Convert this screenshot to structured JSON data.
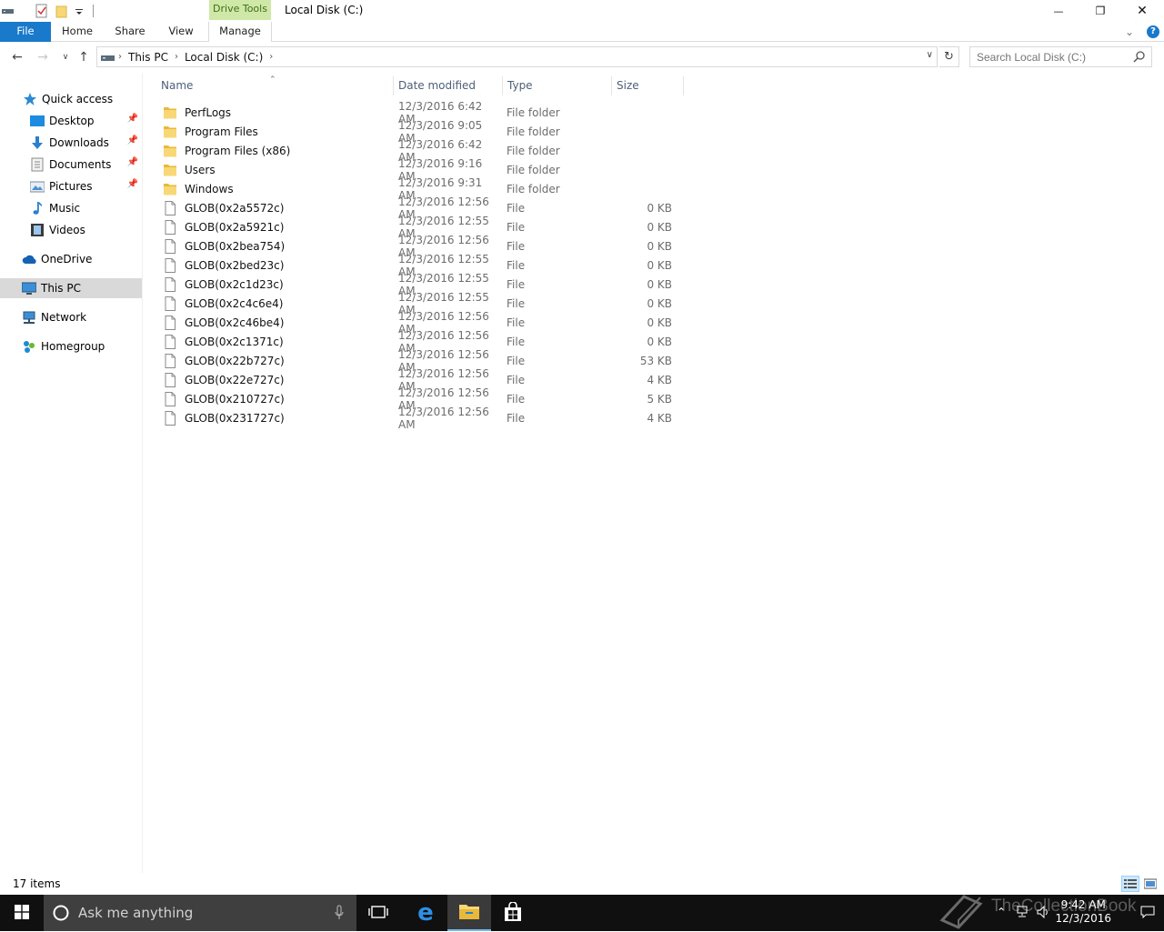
{
  "window": {
    "title": "Local Disk (C:)",
    "context_tab": "Drive Tools",
    "minimize_glyph": "—",
    "maximize_glyph": "❐",
    "close_glyph": "✕"
  },
  "ribbon": {
    "tabs": [
      "File",
      "Home",
      "Share",
      "View",
      "Manage"
    ],
    "collapse_glyph": "⌄",
    "help_glyph": "?"
  },
  "address": {
    "crumbs": [
      "This PC",
      "Local Disk (C:)"
    ],
    "separator": "›",
    "search_placeholder": "Search Local Disk (C:)"
  },
  "nav_pane": {
    "items": [
      {
        "label": "Quick access",
        "icon": "star-icon"
      },
      {
        "label": "Desktop",
        "icon": "desktop-icon",
        "pinned": true
      },
      {
        "label": "Downloads",
        "icon": "download-icon",
        "pinned": true
      },
      {
        "label": "Documents",
        "icon": "documents-icon",
        "pinned": true
      },
      {
        "label": "Pictures",
        "icon": "pictures-icon",
        "pinned": true
      },
      {
        "label": "Music",
        "icon": "music-icon"
      },
      {
        "label": "Videos",
        "icon": "videos-icon"
      },
      {
        "label": "OneDrive",
        "icon": "cloud-icon"
      },
      {
        "label": "This PC",
        "icon": "computer-icon",
        "selected": true
      },
      {
        "label": "Network",
        "icon": "network-icon"
      },
      {
        "label": "Homegroup",
        "icon": "homegroup-icon"
      }
    ]
  },
  "file_list": {
    "columns": [
      "Name",
      "Date modified",
      "Type",
      "Size"
    ],
    "rows": [
      {
        "name": "PerfLogs",
        "date": "12/3/2016 6:42 AM",
        "type": "File folder",
        "size": "",
        "kind": "folder"
      },
      {
        "name": "Program Files",
        "date": "12/3/2016 9:05 AM",
        "type": "File folder",
        "size": "",
        "kind": "folder"
      },
      {
        "name": "Program Files (x86)",
        "date": "12/3/2016 6:42 AM",
        "type": "File folder",
        "size": "",
        "kind": "folder"
      },
      {
        "name": "Users",
        "date": "12/3/2016 9:16 AM",
        "type": "File folder",
        "size": "",
        "kind": "folder"
      },
      {
        "name": "Windows",
        "date": "12/3/2016 9:31 AM",
        "type": "File folder",
        "size": "",
        "kind": "folder"
      },
      {
        "name": "GLOB(0x2a5572c)",
        "date": "12/3/2016 12:56 AM",
        "type": "File",
        "size": "0 KB",
        "kind": "file"
      },
      {
        "name": "GLOB(0x2a5921c)",
        "date": "12/3/2016 12:55 AM",
        "type": "File",
        "size": "0 KB",
        "kind": "file"
      },
      {
        "name": "GLOB(0x2bea754)",
        "date": "12/3/2016 12:56 AM",
        "type": "File",
        "size": "0 KB",
        "kind": "file"
      },
      {
        "name": "GLOB(0x2bed23c)",
        "date": "12/3/2016 12:55 AM",
        "type": "File",
        "size": "0 KB",
        "kind": "file"
      },
      {
        "name": "GLOB(0x2c1d23c)",
        "date": "12/3/2016 12:55 AM",
        "type": "File",
        "size": "0 KB",
        "kind": "file"
      },
      {
        "name": "GLOB(0x2c4c6e4)",
        "date": "12/3/2016 12:55 AM",
        "type": "File",
        "size": "0 KB",
        "kind": "file"
      },
      {
        "name": "GLOB(0x2c46be4)",
        "date": "12/3/2016 12:56 AM",
        "type": "File",
        "size": "0 KB",
        "kind": "file"
      },
      {
        "name": "GLOB(0x2c1371c)",
        "date": "12/3/2016 12:56 AM",
        "type": "File",
        "size": "0 KB",
        "kind": "file"
      },
      {
        "name": "GLOB(0x22b727c)",
        "date": "12/3/2016 12:56 AM",
        "type": "File",
        "size": "53 KB",
        "kind": "file"
      },
      {
        "name": "GLOB(0x22e727c)",
        "date": "12/3/2016 12:56 AM",
        "type": "File",
        "size": "4 KB",
        "kind": "file"
      },
      {
        "name": "GLOB(0x210727c)",
        "date": "12/3/2016 12:56 AM",
        "type": "File",
        "size": "5 KB",
        "kind": "file"
      },
      {
        "name": "GLOB(0x231727c)",
        "date": "12/3/2016 12:56 AM",
        "type": "File",
        "size": "4 KB",
        "kind": "file"
      }
    ]
  },
  "status": {
    "item_count": "17 items"
  },
  "taskbar": {
    "search_placeholder": "Ask me anything",
    "clock_time": "9:42 AM",
    "clock_date": "12/3/2016",
    "watermark": "TheCollectionBook"
  },
  "colors": {
    "accent": "#1979ca",
    "drive_tools_bg": "#cfe8a8",
    "folder": "#f8d775",
    "selection": "#d9d9d9",
    "taskbar": "#101010"
  }
}
